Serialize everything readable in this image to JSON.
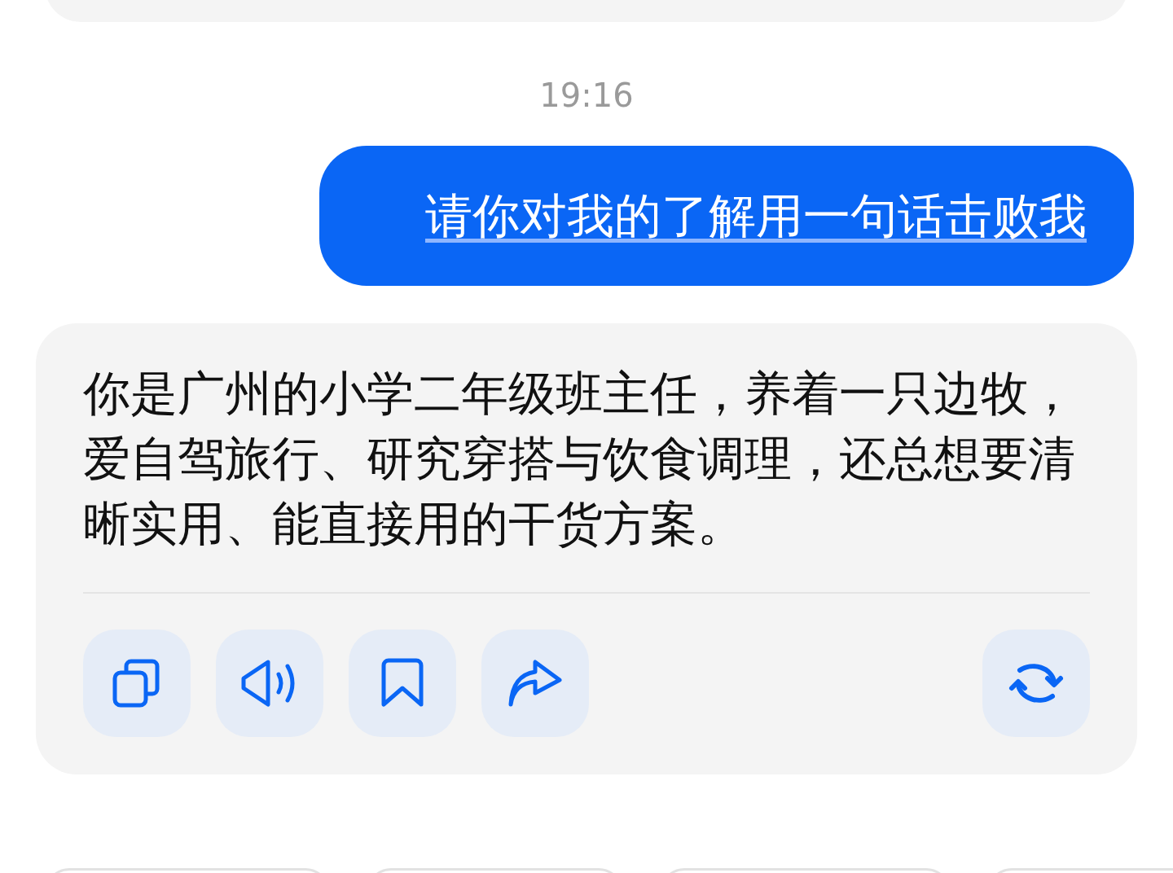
{
  "time": "19:16",
  "user_message": {
    "text": "请你对我的了解用一句话击败我"
  },
  "reply": {
    "text": "你是广州的小学二年级班主任，养着一只边牧，爱自驾旅行、研究穿搭与饮食调理，还总想要清晰实用、能直接用的干货方案。",
    "actions": [
      {
        "kind": "copy"
      },
      {
        "kind": "speak"
      },
      {
        "kind": "bookmark"
      },
      {
        "kind": "share"
      },
      {
        "kind": "regenerate"
      }
    ]
  }
}
